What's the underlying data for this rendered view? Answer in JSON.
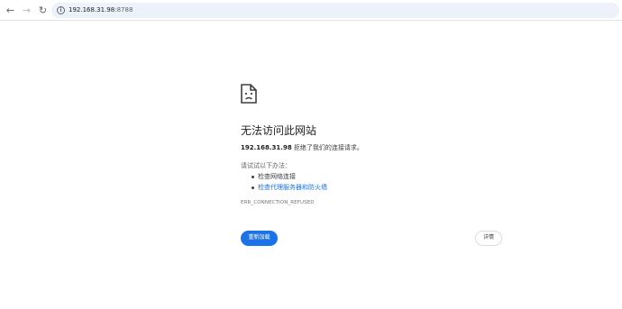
{
  "browser": {
    "url_host": "192.168.31.98",
    "url_rest": ":8788",
    "icons": {
      "back": "arrow-left-icon",
      "forward": "arrow-right-icon",
      "reload": "reload-icon",
      "info": "info-icon"
    }
  },
  "error_page": {
    "icon": "sad-page-icon",
    "title": "无法访问此网站",
    "host": "192.168.31.98",
    "description": " 拒绝了我们的连接请求。",
    "try_label": "请试试以下办法：",
    "suggestions": [
      "检查网络连接",
      "检查代理服务器和防火墙"
    ],
    "error_code": "ERR_CONNECTION_REFUSED",
    "reload_label": "重新加载",
    "details_label": "详情"
  },
  "colors": {
    "accent": "#1a73e8",
    "text": "#202124",
    "secondary_text": "#5f6368",
    "omnibox_bg": "#edf2fa"
  }
}
